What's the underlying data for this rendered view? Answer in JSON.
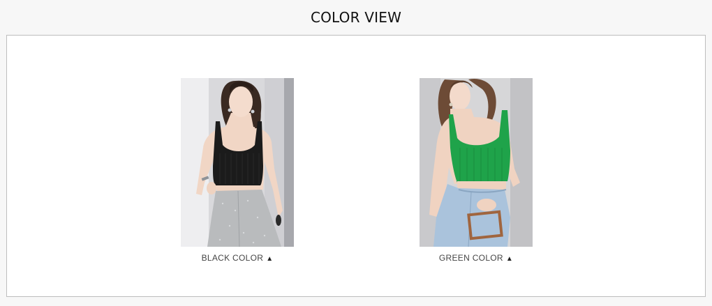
{
  "section": {
    "title": "COLOR VIEW"
  },
  "products": [
    {
      "label": "BLACK COLOR",
      "arrow": "▲",
      "top_color": "#1b1b1b",
      "bottom_color": "#b9bbbd",
      "icon": "triangle-up-icon"
    },
    {
      "label": "GREEN COLOR",
      "arrow": "▲",
      "top_color": "#1fa34a",
      "bottom_color": "#aac3dc",
      "icon": "triangle-up-icon"
    }
  ]
}
